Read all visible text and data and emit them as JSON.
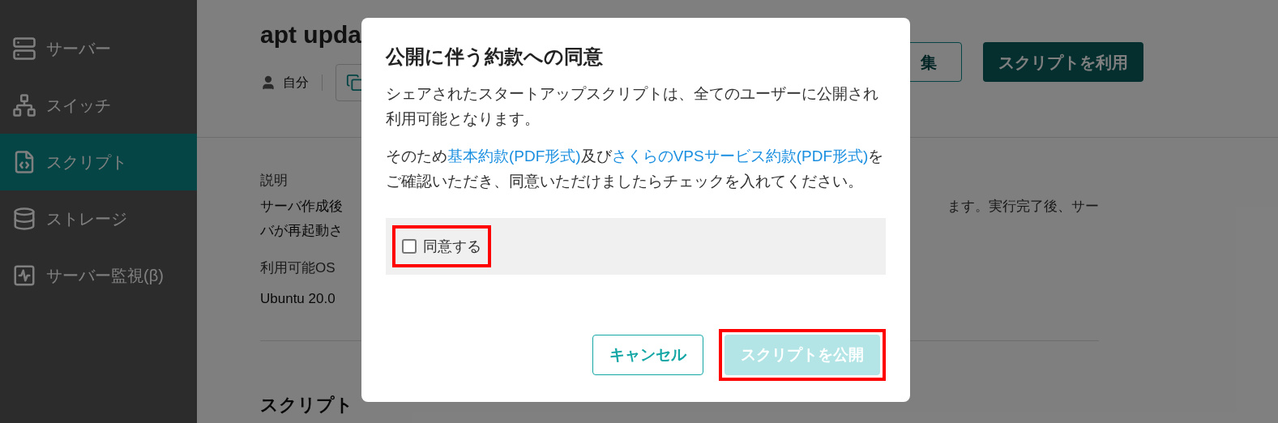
{
  "sidebar": {
    "items": [
      {
        "label": "サーバー",
        "selected": false
      },
      {
        "label": "スイッチ",
        "selected": false
      },
      {
        "label": "スクリプト",
        "selected": true
      },
      {
        "label": "ストレージ",
        "selected": false
      },
      {
        "label": "サーバー監視(β)",
        "selected": false
      }
    ]
  },
  "page": {
    "title": "apt upda",
    "owner": "自分",
    "edit_button": "集",
    "use_button": "スクリプトを利用",
    "description_label": "説明",
    "description_left": [
      "サーバ作成後",
      "バが再起動さ"
    ],
    "description_right": "ます。実行完了後、サー",
    "os_label": "利用可能OS",
    "os_value": "Ubuntu 20.0",
    "details_heading": "スクリプト"
  },
  "dialog": {
    "title": "公開に伴う約款への同意",
    "paragraphs": [
      [
        {
          "text": "シェアされたスタートアップスクリプトは、全てのユーザーに公開され利用可能となります。",
          "kind": "text"
        }
      ],
      [
        {
          "text": "そのため",
          "kind": "text"
        },
        {
          "text": "基本約款(PDF形式)",
          "kind": "link"
        },
        {
          "text": "及び",
          "kind": "text"
        },
        {
          "text": "さくらのVPSサービス約款(PDF形式)",
          "kind": "link"
        },
        {
          "text": "をご確認いただき、同意いただけましたらチェックを入れてください。",
          "kind": "text"
        }
      ]
    ],
    "agree": {
      "label": "同意する",
      "checked": false,
      "highlighted": true
    },
    "buttons": [
      {
        "label": "キャンセル",
        "kind": "secondary",
        "disabled": false,
        "highlighted": false
      },
      {
        "label": "スクリプトを公開",
        "kind": "primary",
        "disabled": true,
        "highlighted": true
      }
    ]
  }
}
